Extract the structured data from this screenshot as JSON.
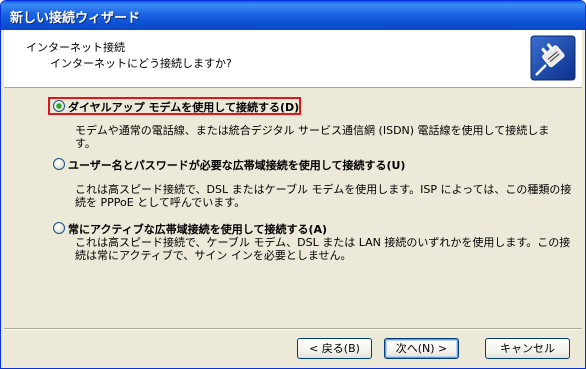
{
  "window": {
    "title": "新しい接続ウィザード"
  },
  "header": {
    "title": "インターネット接続",
    "subtitle": "インターネットにどう接続しますか?",
    "icon": "connection-plug-icon"
  },
  "options": [
    {
      "label": "ダイヤルアップ モデムを使用して接続する(D)",
      "checked": true,
      "desc_lines": [
        "モデムや通常の電話線、または統合デジタル サービス通信網 (ISDN) 電話線を使用して接続しま",
        "す。"
      ]
    },
    {
      "label": "ユーザー名とパスワードが必要な広帯域接続を使用して接続する(U)",
      "checked": false,
      "desc_lines": [
        "これは高スピード接続で、DSL またはケーブル モデムを使用します。ISP によっては、この種類の接",
        "続を PPPoE として呼んでいます。"
      ]
    },
    {
      "label": "常にアクティブな広帯域接続を使用して接続する(A)",
      "checked": false,
      "desc_lines": [
        "これは高スピード接続で、ケーブル モデム、DSL または LAN 接続のいずれかを使用します。この接",
        "続は常にアクティブで、サイン インを必要としません。"
      ]
    }
  ],
  "buttons": {
    "back": "< 戻る(B)",
    "next": "次へ(N) >",
    "cancel": "キャンセル"
  },
  "colors": {
    "titlebar": "#0a5ee8",
    "focus_highlight": "#e3141a",
    "dialog_bg": "#ece9d8"
  }
}
